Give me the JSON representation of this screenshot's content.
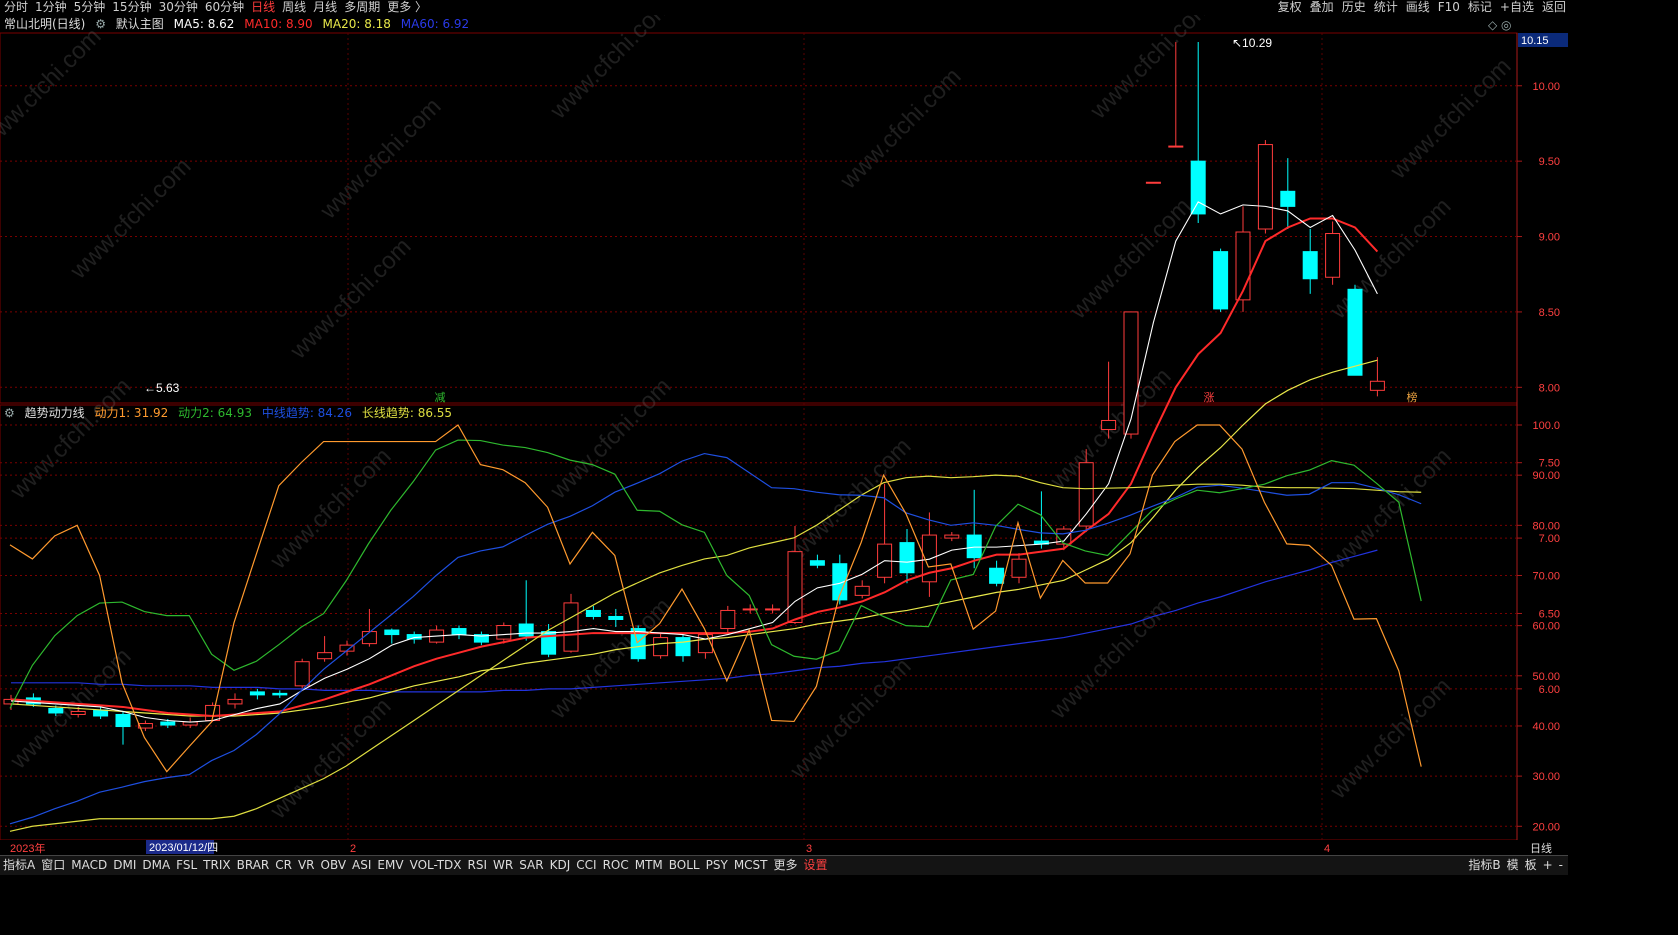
{
  "topbar": {
    "left": [
      "分时",
      "1分钟",
      "5分钟",
      "15分钟",
      "30分钟",
      "60分钟",
      "日线",
      "周线",
      "月线",
      "多周期",
      "更多 〉"
    ],
    "active": "日线",
    "right": [
      "复权",
      "叠加",
      "历史",
      "统计",
      "画线",
      "F10",
      "标记",
      "+自选",
      "返回"
    ]
  },
  "header": {
    "stock": "常山北明(日线)",
    "main": "默认主图",
    "ma5": "MA5: 8.62",
    "ma10": "MA10: 8.90",
    "ma20": "MA20: 8.18",
    "ma60": "MA60: 6.92"
  },
  "ind_header": {
    "name": "趋势动力线",
    "d1": "动力1: 31.92",
    "d2": "动力2: 64.93",
    "mid": "中线趋势: 84.26",
    "long": "长线趋势: 86.55"
  },
  "price_axis": {
    "current": "10.15",
    "ticks": [
      "10.00",
      "9.50",
      "9.00",
      "8.50",
      "8.00",
      "7.50",
      "7.00",
      "6.50",
      "6.00"
    ]
  },
  "ind_axis": {
    "ticks": [
      "100.0",
      "90.00",
      "80.00",
      "70.00",
      "60.00",
      "50.00",
      "40.00",
      "30.00",
      "20.00"
    ]
  },
  "annotations": {
    "high": "10.29",
    "low": "5.63",
    "marks": [
      "减",
      "涨",
      "榜"
    ]
  },
  "date_axis": {
    "year": "2023年",
    "cursor_date": "2023/01/12/四",
    "months": [
      "2",
      "3",
      "4"
    ],
    "period": "日线"
  },
  "bottombar": {
    "left": [
      "指标A",
      "窗口",
      "MACD",
      "DMI",
      "DMA",
      "FSL",
      "TRIX",
      "BRAR",
      "CR",
      "VR",
      "OBV",
      "ASI",
      "EMV",
      "VOL-TDX",
      "RSI",
      "WR",
      "SAR",
      "KDJ",
      "CCI",
      "ROC",
      "MTM",
      "BOLL",
      "PSY",
      "MCST",
      "更多",
      "设置"
    ],
    "right": [
      "指标B",
      "模",
      "板",
      "+",
      "-"
    ]
  },
  "watermark": "www.cfchi.com",
  "colors": {
    "up": "#ff3c3c",
    "down": "#00ffff",
    "ma5": "#ffffff",
    "ma10": "#ff2a2a",
    "ma20": "#e8e84a",
    "ma60": "#2233dd",
    "d1": "#ff9a2e",
    "d2": "#2eb82e",
    "mid": "#1e4fe0",
    "long": "#dede40",
    "grid": "#7a0000"
  },
  "chart_data": {
    "type": "candlestick",
    "candles": [
      [
        5.9,
        5.93,
        5.86,
        5.96
      ],
      [
        5.94,
        5.9,
        5.88,
        5.97
      ],
      [
        5.87,
        5.84,
        5.82,
        5.89
      ],
      [
        5.83,
        5.85,
        5.81,
        5.88
      ],
      [
        5.86,
        5.82,
        5.8,
        5.88
      ],
      [
        5.83,
        5.75,
        5.63,
        5.85
      ],
      [
        5.74,
        5.77,
        5.72,
        5.79
      ],
      [
        5.78,
        5.76,
        5.74,
        5.8
      ],
      [
        5.76,
        5.78,
        5.74,
        5.81
      ],
      [
        5.79,
        5.89,
        5.78,
        5.91
      ],
      [
        5.9,
        5.93,
        5.87,
        5.97
      ],
      [
        5.98,
        5.96,
        5.93,
        6.0
      ],
      [
        5.97,
        5.96,
        5.94,
        5.99
      ],
      [
        6.02,
        6.18,
        6.0,
        6.2
      ],
      [
        6.2,
        6.24,
        6.18,
        6.35
      ],
      [
        6.25,
        6.29,
        6.22,
        6.32
      ],
      [
        6.3,
        6.38,
        6.28,
        6.53
      ],
      [
        6.39,
        6.36,
        6.3,
        6.4
      ],
      [
        6.36,
        6.33,
        6.3,
        6.38
      ],
      [
        6.31,
        6.39,
        6.3,
        6.42
      ],
      [
        6.4,
        6.36,
        6.33,
        6.42
      ],
      [
        6.36,
        6.31,
        6.29,
        6.38
      ],
      [
        6.33,
        6.42,
        6.3,
        6.44
      ],
      [
        6.43,
        6.35,
        6.32,
        6.72
      ],
      [
        6.38,
        6.23,
        6.21,
        6.43
      ],
      [
        6.25,
        6.57,
        6.24,
        6.63
      ],
      [
        6.52,
        6.48,
        6.46,
        6.55
      ],
      [
        6.48,
        6.46,
        6.41,
        6.53
      ],
      [
        6.4,
        6.2,
        6.18,
        6.42
      ],
      [
        6.22,
        6.34,
        6.2,
        6.37
      ],
      [
        6.34,
        6.22,
        6.18,
        6.36
      ],
      [
        6.24,
        6.36,
        6.2,
        6.38
      ],
      [
        6.4,
        6.52,
        6.36,
        6.55
      ],
      [
        6.53,
        6.53,
        6.5,
        6.56
      ],
      [
        6.53,
        6.53,
        6.5,
        6.56
      ],
      [
        6.44,
        6.91,
        6.43,
        7.08
      ],
      [
        6.85,
        6.82,
        6.8,
        6.89
      ],
      [
        6.83,
        6.59,
        6.56,
        6.89
      ],
      [
        6.62,
        6.68,
        6.6,
        6.72
      ],
      [
        6.74,
        6.96,
        6.7,
        7.36
      ],
      [
        6.97,
        6.77,
        6.7,
        7.06
      ],
      [
        6.71,
        7.02,
        6.61,
        7.17
      ],
      [
        7.0,
        7.02,
        6.98,
        7.04
      ],
      [
        7.02,
        6.87,
        6.8,
        7.32
      ],
      [
        6.8,
        6.7,
        6.68,
        6.85
      ],
      [
        6.74,
        6.86,
        6.7,
        6.9
      ],
      [
        6.98,
        6.96,
        6.93,
        7.31
      ],
      [
        6.96,
        7.06,
        6.92,
        7.08
      ],
      [
        7.08,
        7.5,
        7.04,
        7.59
      ],
      [
        7.72,
        7.78,
        7.66,
        8.17
      ],
      [
        7.69,
        8.5,
        7.66,
        8.5
      ],
      [
        9.36,
        9.36,
        9.36,
        9.36
      ],
      [
        9.6,
        9.6,
        9.6,
        10.29
      ],
      [
        9.5,
        9.15,
        9.09,
        10.29
      ],
      [
        8.9,
        8.52,
        8.5,
        8.92
      ],
      [
        8.58,
        9.03,
        8.5,
        9.2
      ],
      [
        9.05,
        9.61,
        9.02,
        9.64
      ],
      [
        9.3,
        9.2,
        9.05,
        9.52
      ],
      [
        8.9,
        8.72,
        8.62,
        9.05
      ],
      [
        8.73,
        9.02,
        8.68,
        9.1
      ],
      [
        8.65,
        8.08,
        8.08,
        8.68
      ],
      [
        7.98,
        8.04,
        7.94,
        8.2
      ]
    ],
    "ma5": [
      5.92,
      5.91,
      5.9,
      5.89,
      5.88,
      5.85,
      5.81,
      5.79,
      5.78,
      5.79,
      5.83,
      5.87,
      5.9,
      5.99,
      6.07,
      6.13,
      6.2,
      6.29,
      6.34,
      6.35,
      6.36,
      6.35,
      6.36,
      6.37,
      6.37,
      6.38,
      6.4,
      6.38,
      6.38,
      6.37,
      6.36,
      6.33,
      6.36,
      6.4,
      6.44,
      6.58,
      6.67,
      6.7,
      6.76,
      6.85,
      6.84,
      6.86,
      6.92,
      6.94,
      6.94,
      6.95,
      6.96,
      6.98,
      7.16,
      7.36,
      7.79,
      8.43,
      8.97,
      9.23,
      9.15,
      9.21,
      9.2,
      9.17,
      9.06,
      9.14,
      8.91,
      8.62
    ],
    "ma10": [
      5.93,
      5.92,
      5.91,
      5.9,
      5.89,
      5.88,
      5.86,
      5.84,
      5.83,
      5.82,
      5.83,
      5.84,
      5.85,
      5.89,
      5.93,
      5.98,
      6.03,
      6.09,
      6.15,
      6.2,
      6.24,
      6.28,
      6.31,
      6.34,
      6.35,
      6.36,
      6.37,
      6.37,
      6.37,
      6.37,
      6.37,
      6.37,
      6.37,
      6.38,
      6.4,
      6.46,
      6.51,
      6.54,
      6.58,
      6.64,
      6.72,
      6.77,
      6.8,
      6.85,
      6.89,
      6.89,
      6.91,
      6.93,
      7.05,
      7.16,
      7.36,
      7.69,
      8.0,
      8.22,
      8.36,
      8.64,
      8.97,
      9.06,
      9.12,
      9.12,
      9.06,
      8.9
    ],
    "ma20": [
      5.9,
      5.89,
      5.88,
      5.87,
      5.86,
      5.85,
      5.84,
      5.83,
      5.82,
      5.82,
      5.82,
      5.83,
      5.84,
      5.86,
      5.88,
      5.91,
      5.94,
      5.98,
      6.02,
      6.05,
      6.08,
      6.12,
      6.14,
      6.17,
      6.19,
      6.21,
      6.23,
      6.26,
      6.28,
      6.3,
      6.31,
      6.33,
      6.34,
      6.36,
      6.38,
      6.4,
      6.43,
      6.45,
      6.47,
      6.5,
      6.52,
      6.55,
      6.58,
      6.61,
      6.64,
      6.66,
      6.69,
      6.72,
      6.79,
      6.86,
      6.97,
      7.14,
      7.32,
      7.47,
      7.6,
      7.75,
      7.89,
      7.98,
      8.05,
      8.1,
      8.14,
      8.18
    ],
    "ma60": [
      6.04,
      6.04,
      6.04,
      6.04,
      6.03,
      6.03,
      6.02,
      6.02,
      6.02,
      6.01,
      6.01,
      6.01,
      6.0,
      6.0,
      5.99,
      5.99,
      5.99,
      5.98,
      5.98,
      5.98,
      5.98,
      5.98,
      5.99,
      5.99,
      6.0,
      6.0,
      6.01,
      6.02,
      6.03,
      6.04,
      6.05,
      6.06,
      6.07,
      6.09,
      6.1,
      6.12,
      6.14,
      6.15,
      6.17,
      6.18,
      6.2,
      6.22,
      6.24,
      6.26,
      6.28,
      6.3,
      6.32,
      6.34,
      6.37,
      6.4,
      6.43,
      6.48,
      6.52,
      6.57,
      6.61,
      6.66,
      6.71,
      6.75,
      6.79,
      6.84,
      6.88,
      6.92
    ],
    "d1": [
      76.1,
      73.3,
      77.9,
      80.0,
      70.0,
      48.6,
      37.7,
      30.9,
      35.9,
      40.8,
      60.6,
      74.3,
      87.9,
      92.5,
      96.7,
      96.7,
      96.7,
      96.7,
      96.7,
      96.7,
      100.0,
      92.1,
      91.1,
      88.5,
      83.6,
      72.3,
      78.6,
      74.0,
      56.6,
      60.4,
      67.3,
      59.4,
      49.0,
      59.1,
      41.1,
      40.9,
      47.9,
      65.6,
      76.6,
      90.0,
      82.3,
      71.7,
      72.3,
      59.3,
      62.9,
      80.5,
      65.5,
      73.0,
      68.5,
      68.5,
      74.3,
      90.0,
      96.7,
      100.0,
      100.0,
      95.2,
      84.6,
      76.3,
      76.0,
      72.0,
      61.3,
      61.4,
      51.0,
      31.9
    ],
    "d2": [
      43.5,
      52.1,
      58.0,
      62.0,
      64.5,
      64.7,
      62.8,
      62.0,
      62.0,
      54.3,
      51.1,
      52.9,
      56.2,
      59.7,
      62.4,
      68.9,
      76.3,
      83.0,
      88.7,
      95.0,
      97.0,
      96.9,
      96.0,
      95.5,
      94.5,
      93.0,
      92.1,
      90.2,
      83.0,
      82.8,
      80.1,
      78.6,
      70.0,
      66.0,
      56.2,
      53.9,
      53.3,
      55.0,
      64.0,
      61.8,
      60.0,
      59.8,
      69.1,
      70.2,
      79.8,
      84.2,
      82.1,
      76.5,
      74.9,
      74.0,
      78.5,
      83.0,
      85.2,
      87.0,
      86.5,
      87.3,
      88.2,
      89.9,
      91.0,
      92.9,
      92.0,
      88.4,
      84.6,
      64.9
    ],
    "mid": [
      20.5,
      21.8,
      23.5,
      25.0,
      26.8,
      27.8,
      28.9,
      29.7,
      30.3,
      33.1,
      35.1,
      38.3,
      42.3,
      47.0,
      51.3,
      54.9,
      58.5,
      62.1,
      65.8,
      69.9,
      73.6,
      74.9,
      75.7,
      78.0,
      80.2,
      81.8,
      83.9,
      86.6,
      88.4,
      90.3,
      92.8,
      94.3,
      93.5,
      90.5,
      87.5,
      87.3,
      86.6,
      86.1,
      86.0,
      85.5,
      82.5,
      81.1,
      80.0,
      80.5,
      80.0,
      79.2,
      78.5,
      78.3,
      79.0,
      80.4,
      82.0,
      83.8,
      85.5,
      87.6,
      88.0,
      87.4,
      86.7,
      86.0,
      86.2,
      88.5,
      88.5,
      87.4,
      86.1,
      84.3
    ],
    "long": [
      19.0,
      20.0,
      20.5,
      21.0,
      21.5,
      21.5,
      21.5,
      21.5,
      21.5,
      21.5,
      22.0,
      23.5,
      25.5,
      27.5,
      29.5,
      32.0,
      35.0,
      38.0,
      41.0,
      44.0,
      47.0,
      50.0,
      53.0,
      56.0,
      59.0,
      61.5,
      64.0,
      66.5,
      68.5,
      70.5,
      72.0,
      73.3,
      74.0,
      75.5,
      76.5,
      77.5,
      80.0,
      83.0,
      86.0,
      88.5,
      89.5,
      89.8,
      89.5,
      89.7,
      90.0,
      89.8,
      88.5,
      87.5,
      87.3,
      87.4,
      87.5,
      87.7,
      88.0,
      88.2,
      88.2,
      88.0,
      87.6,
      87.5,
      87.5,
      87.4,
      87.3,
      87.0,
      86.7,
      86.6
    ]
  }
}
